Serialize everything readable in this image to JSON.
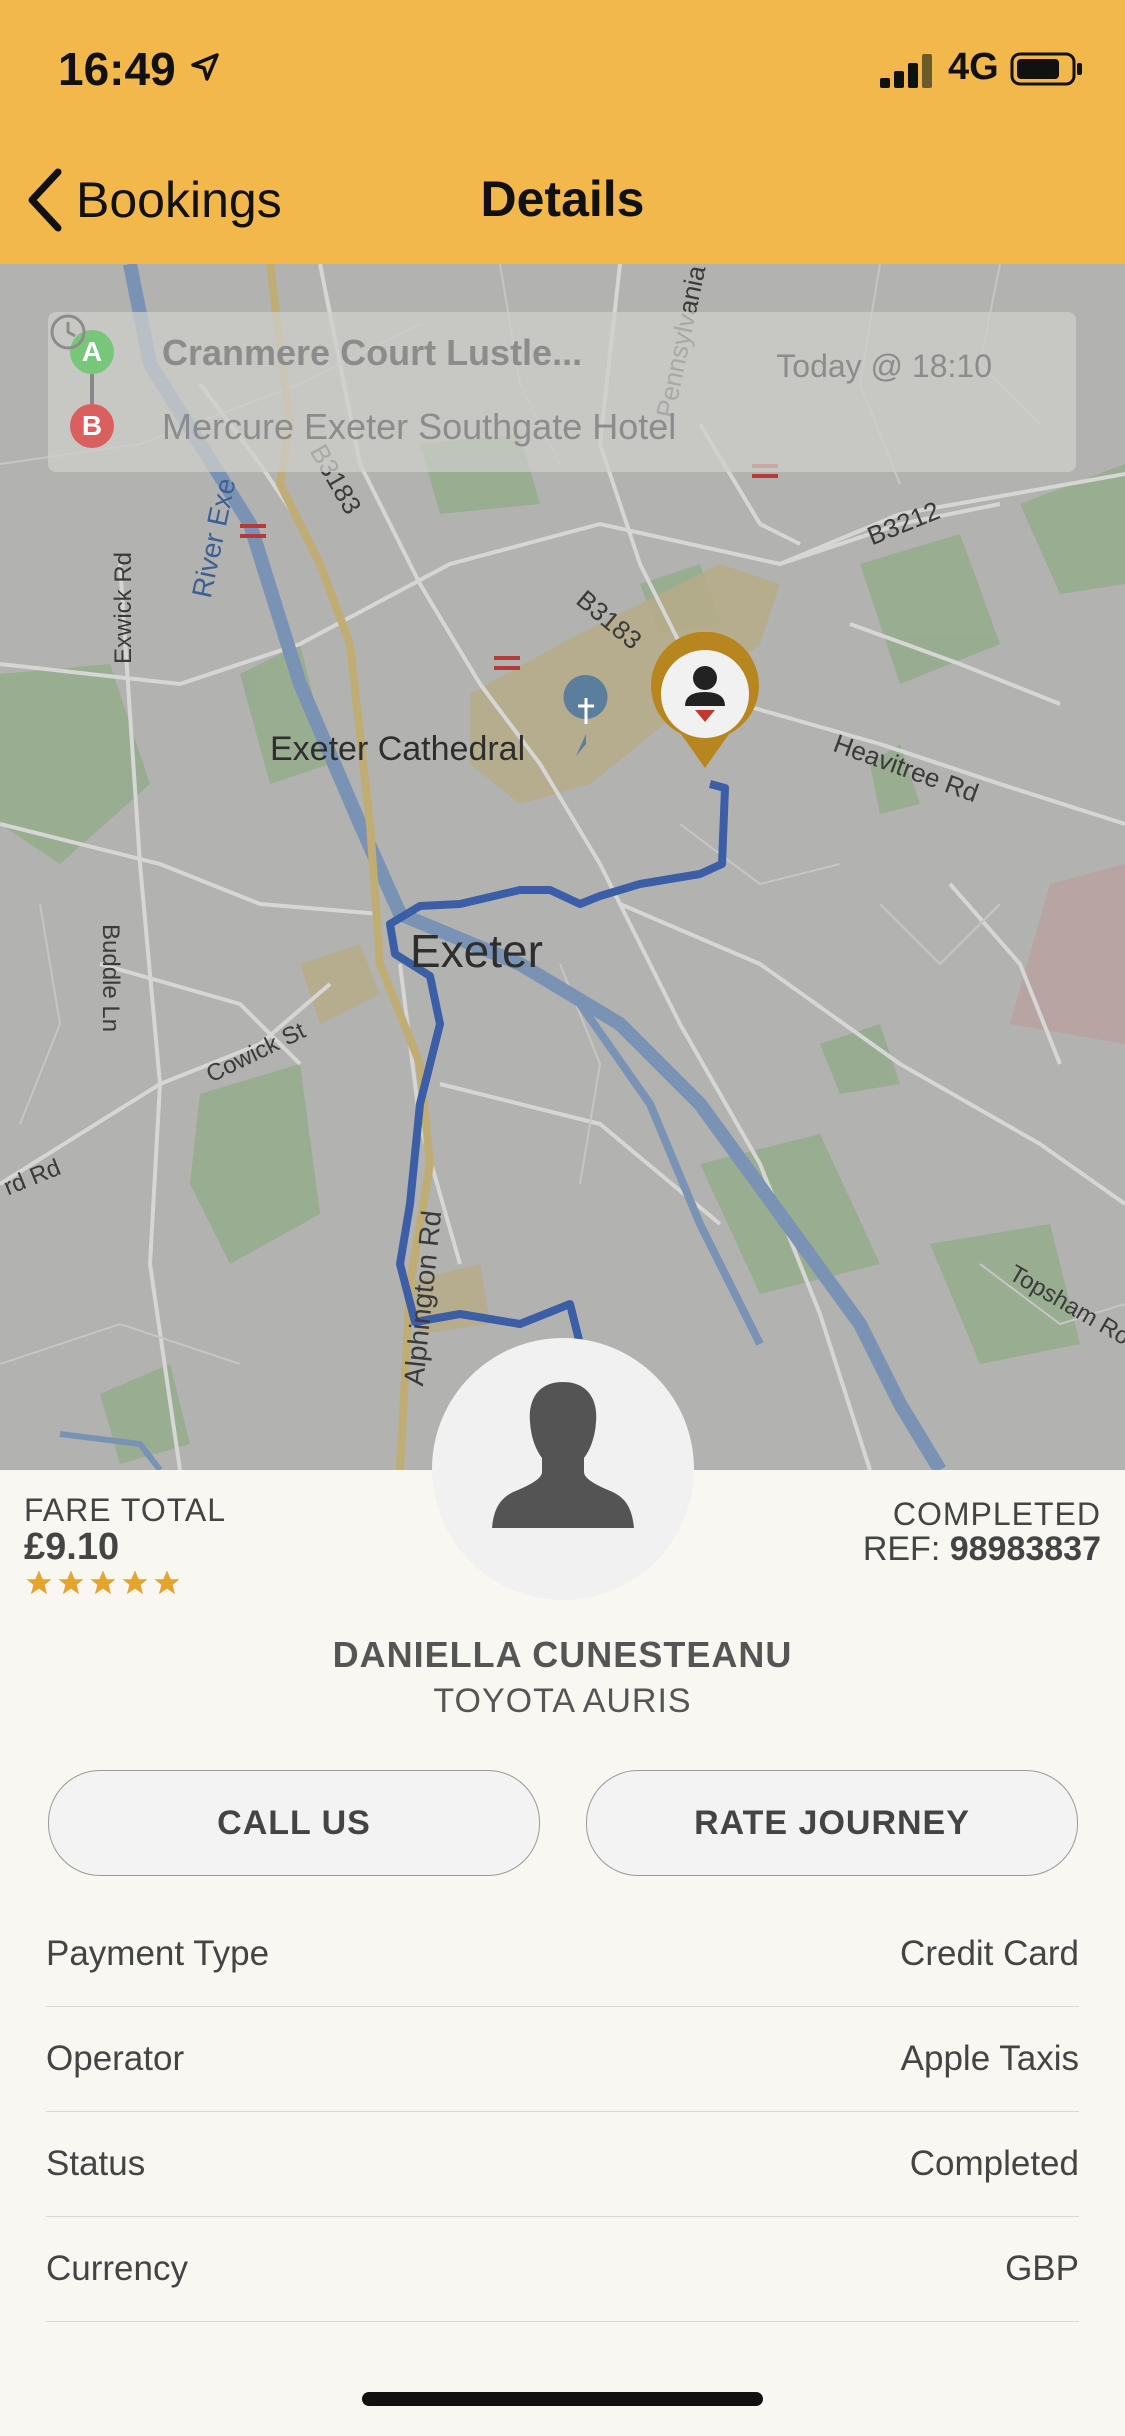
{
  "status_bar": {
    "time": "16:49",
    "network": "4G"
  },
  "nav": {
    "back_label": "Bookings",
    "title": "Details"
  },
  "booking": {
    "pickup": "Cranmere Court Lustle...",
    "dropoff": "Mercure Exeter Southgate Hotel",
    "time": "Today @ 18:10",
    "pickup_marker": "A",
    "dropoff_marker": "B"
  },
  "map": {
    "city": "Exeter",
    "landmark": "Exeter Cathedral",
    "roads": [
      "Pennsylvania Rd",
      "B3183",
      "B3212",
      "B3183",
      "Heavitree Rd",
      "Exwick Rd",
      "River Exe",
      "Buddle Ln",
      "Cowick St",
      "rd Rd",
      "Alphington Rd",
      "Topsham Ro"
    ]
  },
  "fare": {
    "label": "FARE TOTAL",
    "value": "£9.10",
    "rating": 5
  },
  "status": {
    "label": "COMPLETED",
    "ref_prefix": "REF:",
    "ref_number": "98983837"
  },
  "driver": {
    "name": "DANIELLA CUNESTEANU",
    "vehicle": "TOYOTA AURIS"
  },
  "actions": {
    "call_label": "CALL US",
    "rate_label": "RATE JOURNEY"
  },
  "details": [
    {
      "label": "Payment Type",
      "value": "Credit Card"
    },
    {
      "label": "Operator",
      "value": "Apple Taxis"
    },
    {
      "label": "Status",
      "value": "Completed"
    },
    {
      "label": "Currency",
      "value": "GBP"
    }
  ],
  "colors": {
    "header": "#f2b84b",
    "star": "#e3a430",
    "route": "#3b5ea6",
    "pin": "#b8861f"
  }
}
